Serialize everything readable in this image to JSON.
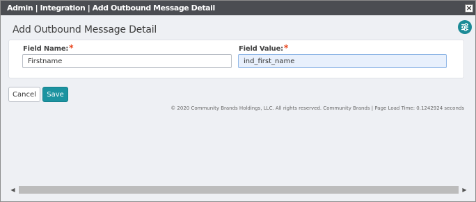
{
  "window": {
    "title": "Admin | Integration | Add Outbound Message Detail",
    "close_glyph": "×"
  },
  "page": {
    "heading": "Add Outbound Message Detail",
    "settings_icon": "sliders-icon",
    "accent_color": "#1b8a96"
  },
  "form": {
    "field_name": {
      "label": "Field Name:",
      "required_mark": "*",
      "value": "Firstname"
    },
    "field_value": {
      "label": "Field Value:",
      "required_mark": "*",
      "value": "ind_first_name"
    }
  },
  "actions": {
    "cancel_label": "Cancel",
    "save_label": "Save"
  },
  "footer": {
    "text": "© 2020 Community Brands Holdings, LLC. All rights reserved. Community Brands | Page Load Time: 0.1242924 seconds"
  },
  "scrollbar": {
    "left_arrow": "◀",
    "right_arrow": "▶"
  }
}
